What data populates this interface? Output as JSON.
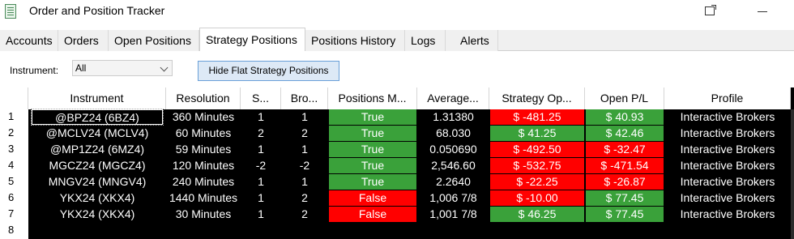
{
  "window": {
    "title": "Order and Position Tracker",
    "icon": "spreadsheet-icon"
  },
  "tabs": [
    "Accounts",
    "Orders",
    "Open Positions",
    "Strategy Positions",
    "Positions History",
    "Logs",
    "Alerts"
  ],
  "active_tab": "Strategy Positions",
  "filter": {
    "label": "Instrument:",
    "value": "All",
    "hide_button": "Hide Flat Strategy Positions"
  },
  "columns": [
    "Instrument",
    "Resolution",
    "S...",
    "Bro...",
    "Positions M...",
    "Average...",
    "Strategy Op...",
    "Open P/L",
    "Profile"
  ],
  "row_numbers": [
    "1",
    "2",
    "3",
    "4",
    "5",
    "6",
    "7",
    "8"
  ],
  "rows": [
    {
      "instrument": "@BPZ24 (6BZ4)",
      "resolution": "360 Minutes",
      "s": "1",
      "bro": "1",
      "pos_match": "True",
      "average": "1.31380",
      "strategy_pl": "$ -481.25",
      "open_pl": "$ 40.93",
      "profile": "Interactive Brokers"
    },
    {
      "instrument": "@MCLV24 (MCLV4)",
      "resolution": "60 Minutes",
      "s": "2",
      "bro": "2",
      "pos_match": "True",
      "average": "68.030",
      "strategy_pl": "$ 41.25",
      "open_pl": "$ 42.46",
      "profile": "Interactive Brokers"
    },
    {
      "instrument": "@MP1Z24 (6MZ4)",
      "resolution": "59 Minutes",
      "s": "1",
      "bro": "1",
      "pos_match": "True",
      "average": "0.050690",
      "strategy_pl": "$ -492.50",
      "open_pl": "$ -32.47",
      "profile": "Interactive Brokers"
    },
    {
      "instrument": "MGCZ24 (MGCZ4)",
      "resolution": "120 Minutes",
      "s": "-2",
      "bro": "-2",
      "pos_match": "True",
      "average": "2,546.60",
      "strategy_pl": "$ -532.75",
      "open_pl": "$ -471.54",
      "profile": "Interactive Brokers"
    },
    {
      "instrument": "MNGV24 (MNGV4)",
      "resolution": "240 Minutes",
      "s": "1",
      "bro": "1",
      "pos_match": "True",
      "average": "2.2640",
      "strategy_pl": "$ -22.25",
      "open_pl": "$ -26.87",
      "profile": "Interactive Brokers"
    },
    {
      "instrument": "YKX24 (XKX4)",
      "resolution": "1440 Minutes",
      "s": "1",
      "bro": "2",
      "pos_match": "False",
      "average": "1,006 7/8",
      "strategy_pl": "$ -10.00",
      "open_pl": "$ 77.45",
      "profile": "Interactive Brokers"
    },
    {
      "instrument": "YKX24 (XKX4)",
      "resolution": "30 Minutes",
      "s": "1",
      "bro": "2",
      "pos_match": "False",
      "average": "1,001 7/8",
      "strategy_pl": "$ 46.25",
      "open_pl": "$ 77.45",
      "profile": "Interactive Brokers"
    }
  ],
  "colors": {
    "positive": "#3aa13a",
    "negative": "#ff0000",
    "grid_background": "#000000"
  }
}
